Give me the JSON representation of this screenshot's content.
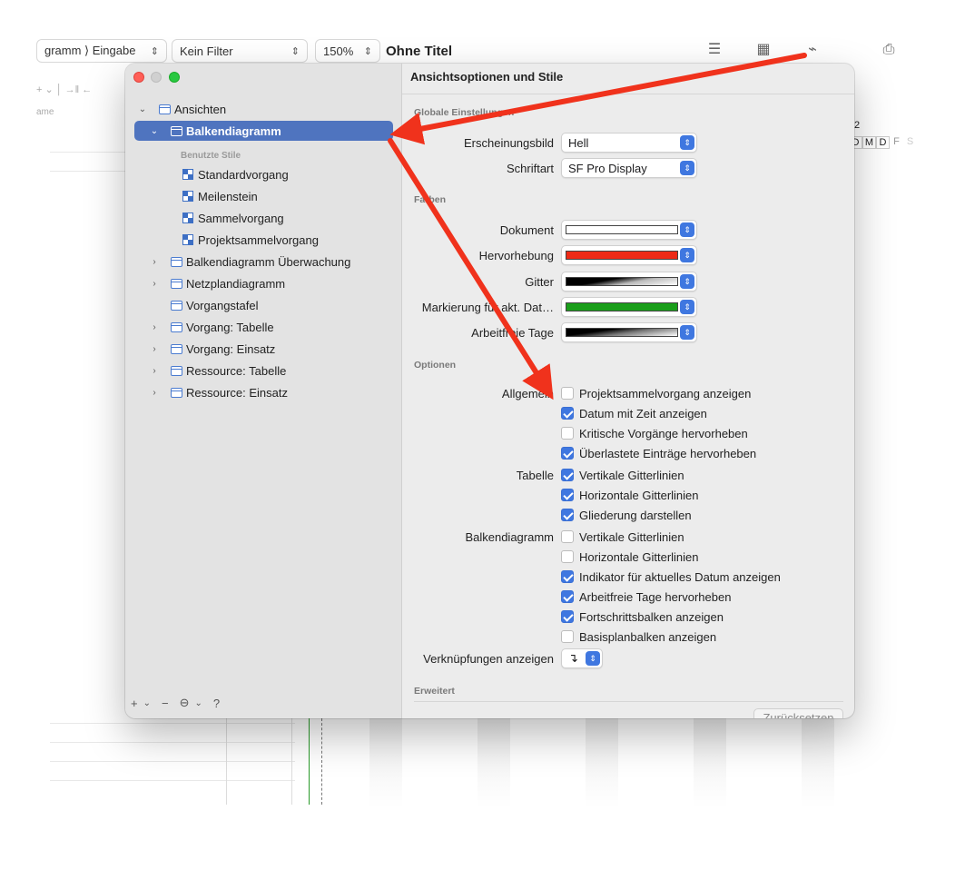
{
  "background": {
    "toolbar": {
      "view_selector": "gramm ⟩ Eingabe",
      "filter_selector": "Kein Filter",
      "zoom_selector": "150%",
      "document_title": "Ohne Titel"
    },
    "column_header": "ame",
    "timeline_header": {
      "year_fragment": "2",
      "days": [
        "D",
        "M",
        "D",
        "F",
        "S"
      ]
    }
  },
  "dialog": {
    "title": "Ansichtsoptionen und Stile",
    "sidebar": {
      "used_styles_heading": "Benutzte Stile",
      "items": [
        {
          "label": "Ansichten",
          "disclosure": "⌄"
        },
        {
          "label": "Balkendiagramm",
          "disclosure": "⌄",
          "selected": true
        },
        {
          "label": "Standardvorgang"
        },
        {
          "label": "Meilenstein"
        },
        {
          "label": "Sammelvorgang"
        },
        {
          "label": "Projektsammelvorgang"
        },
        {
          "label": "Balkendiagramm Überwachung",
          "disclosure": "›"
        },
        {
          "label": "Netzplandiagramm",
          "disclosure": "›"
        },
        {
          "label": "Vorgangstafel"
        },
        {
          "label": "Vorgang: Tabelle",
          "disclosure": "›"
        },
        {
          "label": "Vorgang: Einsatz",
          "disclosure": "›"
        },
        {
          "label": "Ressource: Tabelle",
          "disclosure": "›"
        },
        {
          "label": "Ressource: Einsatz",
          "disclosure": "›"
        }
      ],
      "footer": {
        "add": "+",
        "add_menu": "⌄",
        "remove": "−",
        "more": "⊖",
        "more_menu": "⌄",
        "help": "?"
      }
    },
    "global": {
      "heading": "Globale Einstellungen",
      "appearance_label": "Erscheinungsbild",
      "appearance_value": "Hell",
      "font_label": "Schriftart",
      "font_value": "SF Pro Display"
    },
    "colors": {
      "heading": "Farben",
      "items": [
        {
          "label": "Dokument",
          "color": "#ffffff"
        },
        {
          "label": "Hervorhebung",
          "color": "#ee2a16"
        },
        {
          "label": "Gitter",
          "color": "gradient-black"
        },
        {
          "label": "Markierung für akt. Dat…",
          "color": "#1a9e1a"
        },
        {
          "label": "Arbeitfreie Tage",
          "color": "gradient-black"
        }
      ]
    },
    "options": {
      "heading": "Optionen",
      "general_label": "Allgemein",
      "general": [
        {
          "label": "Projektsammelvorgang anzeigen",
          "checked": false
        },
        {
          "label": "Datum mit Zeit anzeigen",
          "checked": true
        },
        {
          "label": "Kritische Vorgänge hervorheben",
          "checked": false
        },
        {
          "label": "Überlastete Einträge hervorheben",
          "checked": true
        }
      ],
      "table_label": "Tabelle",
      "table": [
        {
          "label": "Vertikale Gitterlinien",
          "checked": true
        },
        {
          "label": "Horizontale Gitterlinien",
          "checked": true
        },
        {
          "label": "Gliederung darstellen",
          "checked": true
        }
      ],
      "gantt_label": "Balkendiagramm",
      "gantt": [
        {
          "label": "Vertikale Gitterlinien",
          "checked": false
        },
        {
          "label": "Horizontale Gitterlinien",
          "checked": false
        },
        {
          "label": "Indikator für aktuelles Datum anzeigen",
          "checked": true
        },
        {
          "label": "Arbeitfreie Tage hervorheben",
          "checked": true
        },
        {
          "label": "Fortschrittsbalken anzeigen",
          "checked": true
        },
        {
          "label": "Basisplanbalken anzeigen",
          "checked": false
        }
      ],
      "links_label": "Verknüpfungen anzeigen",
      "links_value": "↴"
    },
    "advanced": {
      "heading": "Erweitert",
      "reset_label": "Zurücksetzen"
    }
  },
  "annotation_color": "#f0321c"
}
